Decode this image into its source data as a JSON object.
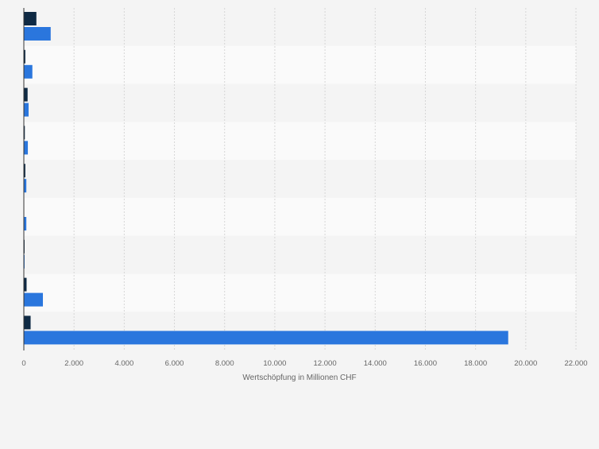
{
  "chart_data": {
    "type": "bar",
    "orientation": "horizontal",
    "categories": [
      "",
      "",
      "",
      "",
      "",
      "",
      "",
      "",
      ""
    ],
    "series": [
      {
        "values": [
          500,
          60,
          150,
          40,
          60,
          10,
          30,
          110,
          270
        ],
        "color": "#0f2a44"
      },
      {
        "values": [
          1070,
          340,
          190,
          160,
          100,
          100,
          30,
          760,
          19300
        ],
        "color": "#2a76dd"
      }
    ],
    "xlabel": "Wertschöpfung in Millionen CHF",
    "ylabel": "",
    "xlim": [
      0,
      22000
    ],
    "xticks": [
      0,
      2000,
      4000,
      6000,
      8000,
      10000,
      12000,
      14000,
      16000,
      18000,
      20000,
      22000
    ],
    "xtick_labels": [
      "0",
      "2.000",
      "4.000",
      "6.000",
      "8.000",
      "10.000",
      "12.000",
      "14.000",
      "16.000",
      "18.000",
      "20.000",
      "22.000"
    ],
    "grid": true,
    "band_colors": [
      "#f4f4f4",
      "#fafafa"
    ]
  }
}
